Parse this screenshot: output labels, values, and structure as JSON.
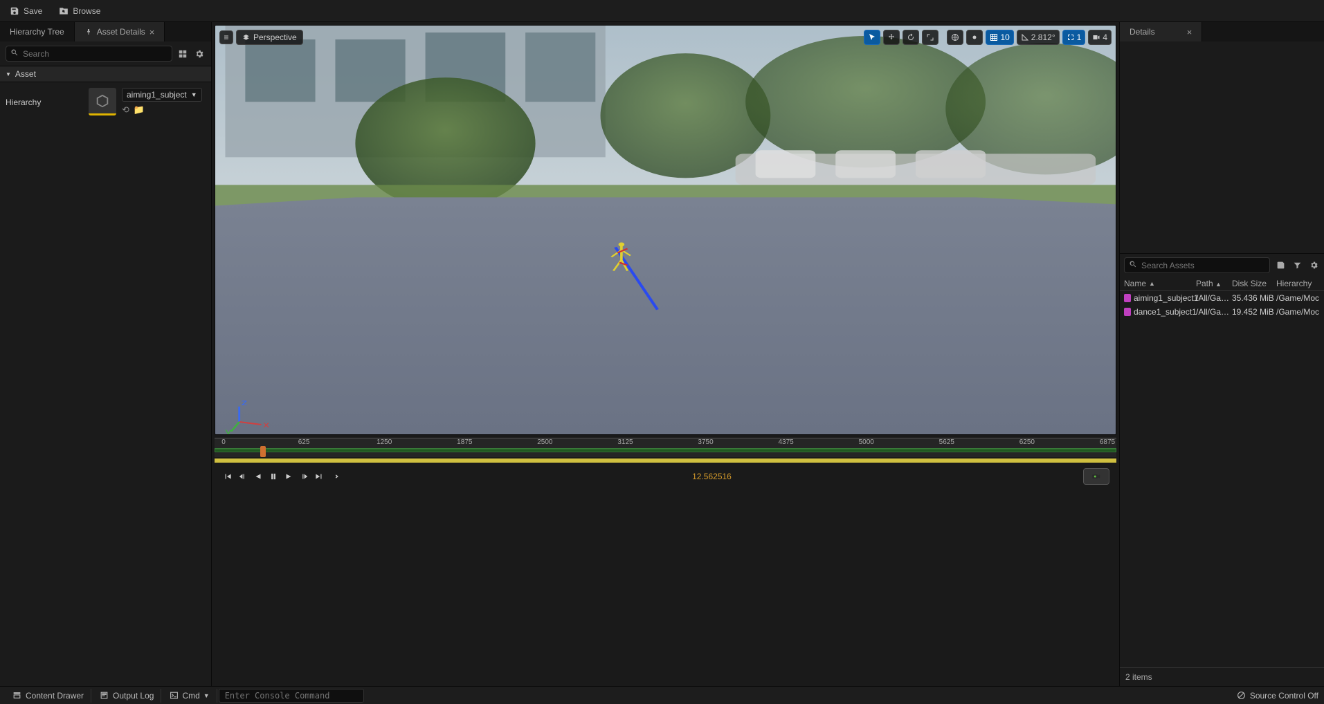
{
  "toolbar": {
    "save_label": "Save",
    "browse_label": "Browse"
  },
  "left": {
    "tabs": {
      "hierarchy": "Hierarchy Tree",
      "asset_details": "Asset Details"
    },
    "search_placeholder": "Search",
    "section_asset": "Asset",
    "hierarchy_label": "Hierarchy",
    "asset_name": "aiming1_subject"
  },
  "viewport": {
    "perspective_label": "Perspective",
    "grid_value": "10",
    "angle_value": "2.812°",
    "scale_value": "1",
    "cam_value": "4"
  },
  "timeline": {
    "ticks": [
      "0",
      "625",
      "1250",
      "1875",
      "2500",
      "3125",
      "3750",
      "4375",
      "5000",
      "5625",
      "6250",
      "6875"
    ],
    "frame": "12.562516",
    "playhead_pct": 5.3
  },
  "right": {
    "details_tab": "Details",
    "search_placeholder": "Search Assets",
    "columns": {
      "name": "Name",
      "path": "Path",
      "size": "Disk Size",
      "hier": "Hierarchy"
    },
    "rows": [
      {
        "name": "aiming1_subject1",
        "path": "/All/Game,",
        "size": "35.436 MiB",
        "hier": "/Game/Moc"
      },
      {
        "name": "dance1_subject1",
        "path": "/All/Game,",
        "size": "19.452 MiB",
        "hier": "/Game/Moc"
      }
    ],
    "footer": "2 items"
  },
  "bottom": {
    "content_drawer": "Content Drawer",
    "output_log": "Output Log",
    "cmd_label": "Cmd",
    "console_placeholder": "Enter Console Command",
    "source_control": "Source Control Off"
  }
}
